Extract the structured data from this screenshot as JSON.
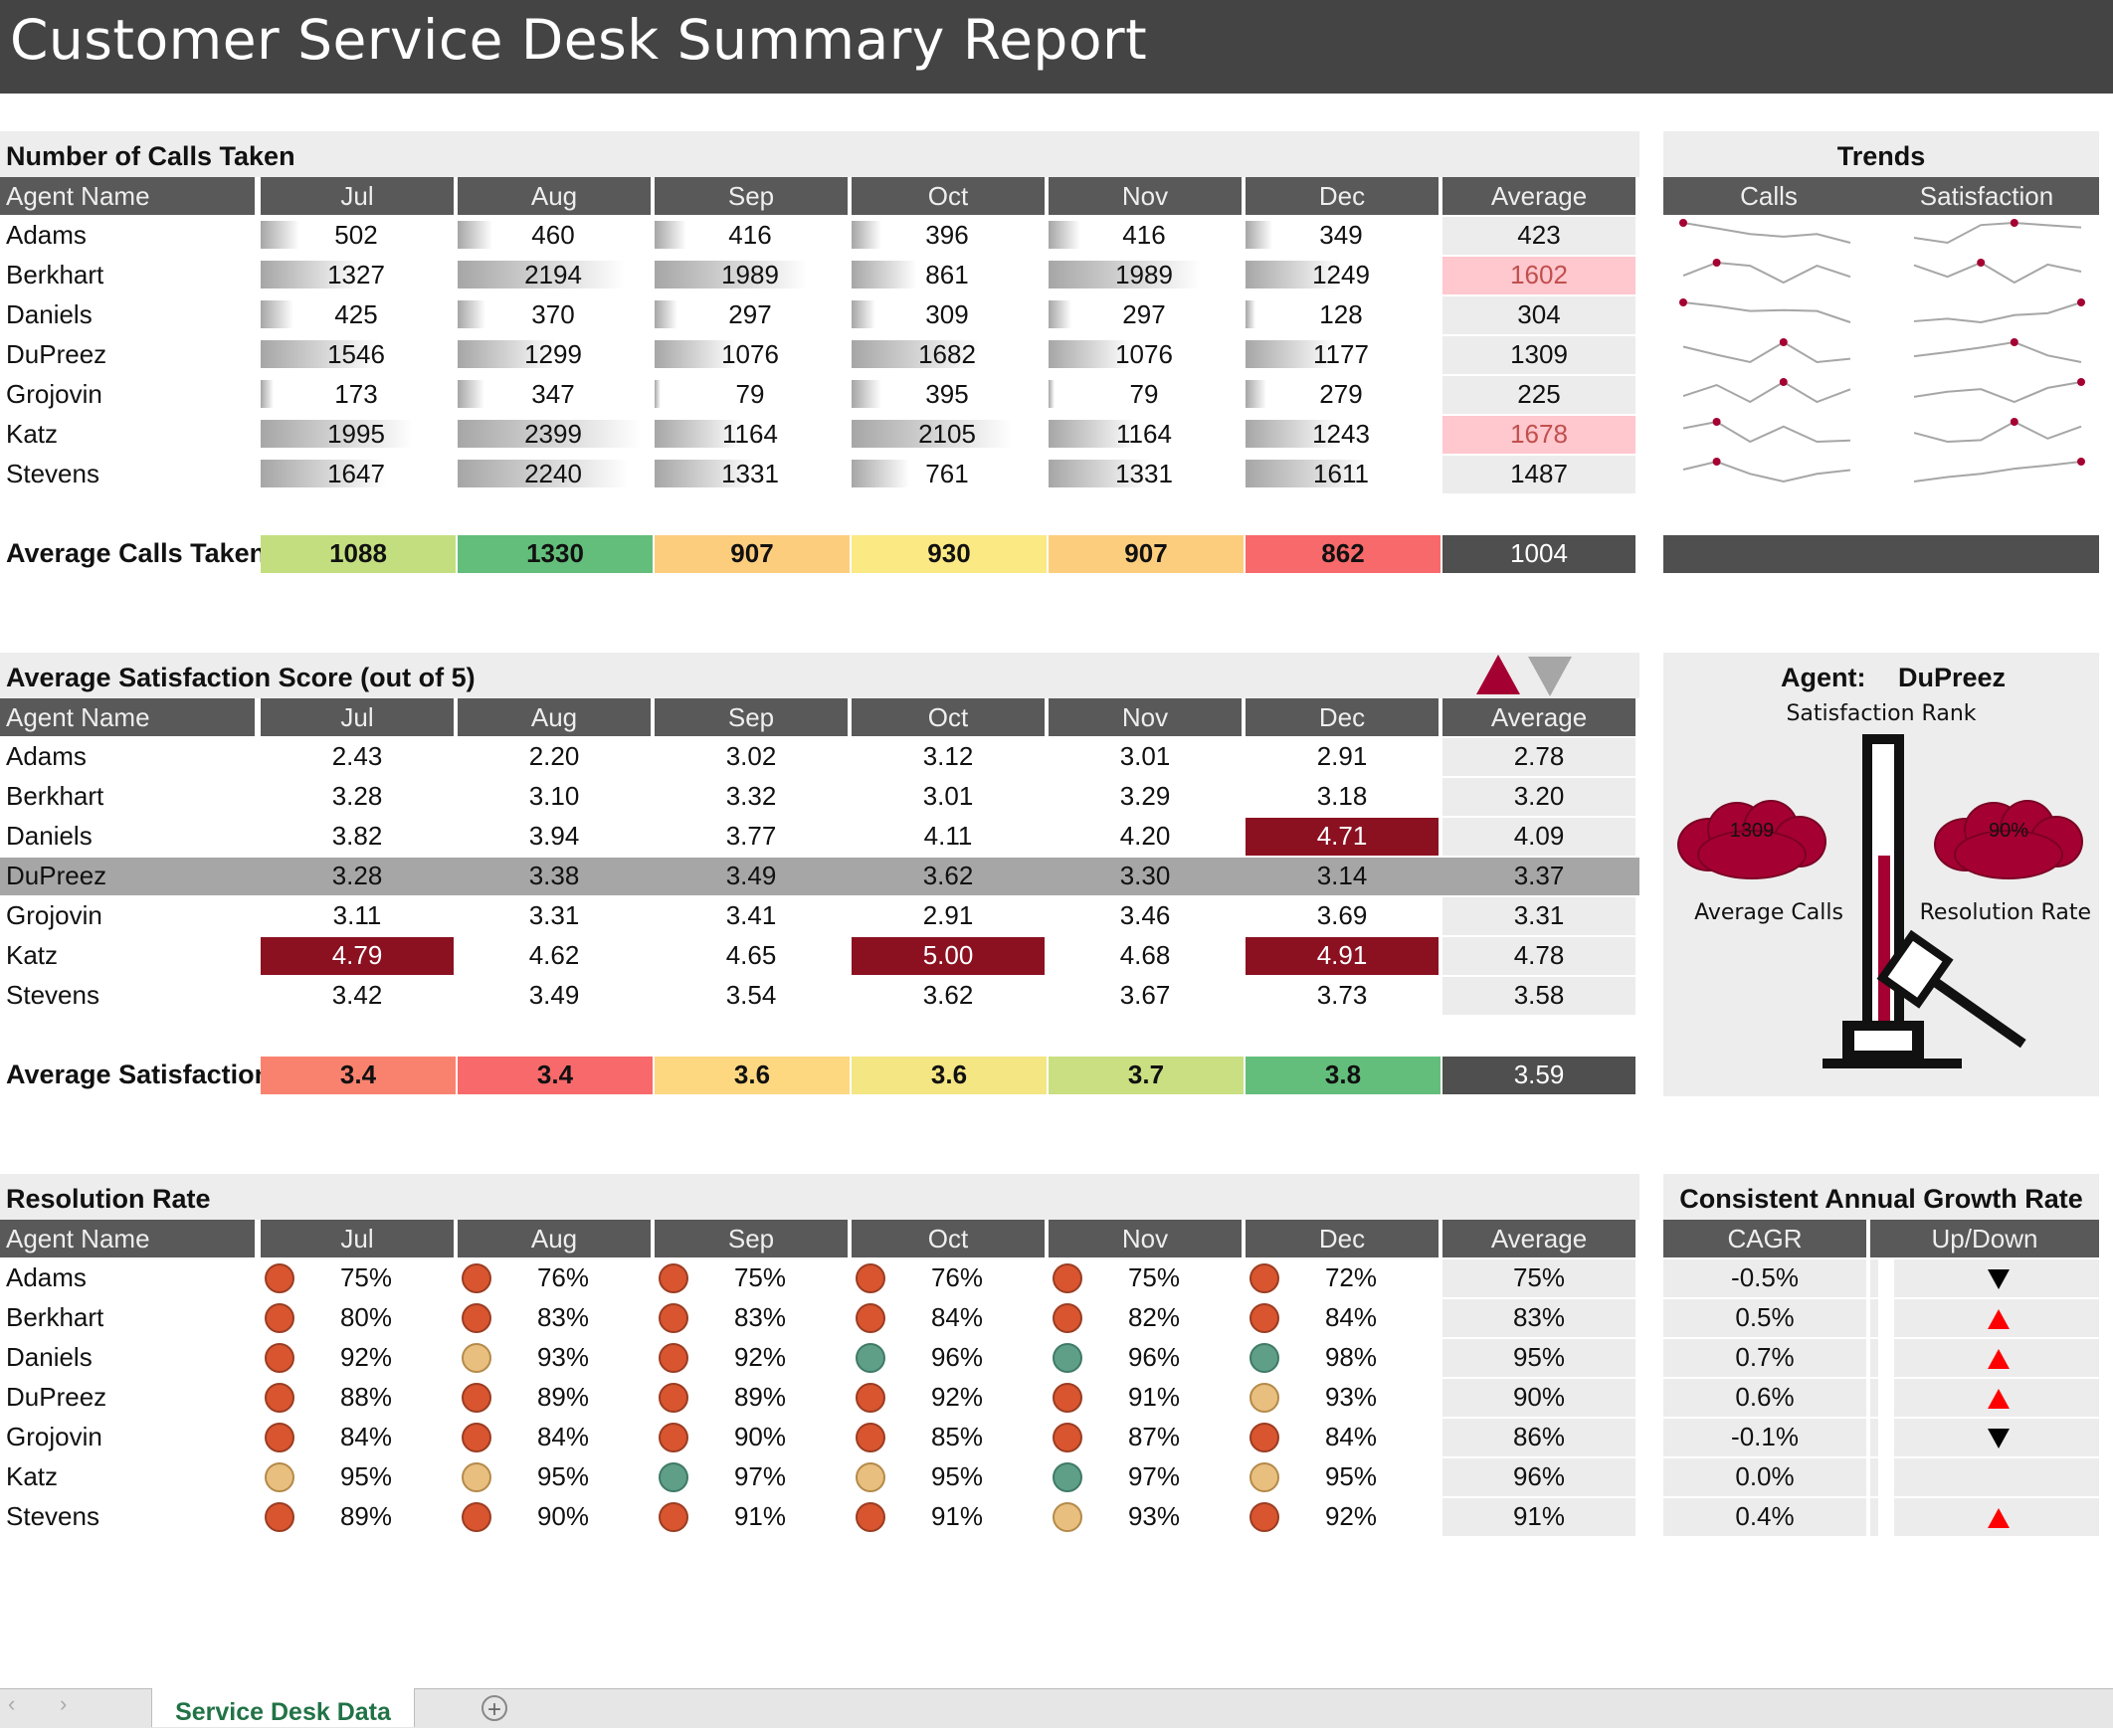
{
  "title": "Customer Service Desk Summary Report",
  "months": [
    "Jul",
    "Aug",
    "Sep",
    "Oct",
    "Nov",
    "Dec"
  ],
  "agent_col": "Agent Name",
  "avg_col": "Average",
  "agents": [
    "Adams",
    "Berkhart",
    "Daniels",
    "DuPreez",
    "Grojovin",
    "Katz",
    "Stevens"
  ],
  "calls": {
    "title": "Number of Calls Taken",
    "rows": [
      [
        "502",
        "460",
        "416",
        "396",
        "416",
        "349",
        "423"
      ],
      [
        "1327",
        "2194",
        "1989",
        "861",
        "1989",
        "1249",
        "1602"
      ],
      [
        "425",
        "370",
        "297",
        "309",
        "297",
        "128",
        "304"
      ],
      [
        "1546",
        "1299",
        "1076",
        "1682",
        "1076",
        "1177",
        "1309"
      ],
      [
        "173",
        "347",
        "79",
        "395",
        "79",
        "279",
        "225"
      ],
      [
        "1995",
        "2399",
        "1164",
        "2105",
        "1164",
        "1243",
        "1678"
      ],
      [
        "1647",
        "2240",
        "1331",
        "761",
        "1331",
        "1611",
        "1487"
      ]
    ],
    "bar_max": 2399,
    "avg_highlight_rows": [
      1,
      5
    ],
    "avg_highlight_color": "#ffc7ce",
    "avg_highlight_text": "#c0504d",
    "summary_label": "Average Calls Taken",
    "summary_values": [
      "1088",
      "1330",
      "907",
      "930",
      "907",
      "862",
      "1004"
    ],
    "summary_colors": [
      "#c3de7f",
      "#63be7b",
      "#fdcd7e",
      "#fbe983",
      "#fdcd7e",
      "#f8696b",
      "#4f4f4f"
    ]
  },
  "trends": {
    "title": "Trends",
    "col_calls": "Calls",
    "col_satisfaction": "Satisfaction",
    "line_color": "#a6a6a6",
    "marker_color": "#a50032"
  },
  "satisfaction": {
    "title": "Average Satisfaction Score (out of 5)",
    "rows": [
      [
        "2.43",
        "2.20",
        "3.02",
        "3.12",
        "3.01",
        "2.91",
        "2.78"
      ],
      [
        "3.28",
        "3.10",
        "3.32",
        "3.01",
        "3.29",
        "3.18",
        "3.20"
      ],
      [
        "3.82",
        "3.94",
        "3.77",
        "4.11",
        "4.20",
        "4.71",
        "4.09"
      ],
      [
        "3.28",
        "3.38",
        "3.49",
        "3.62",
        "3.30",
        "3.14",
        "3.37"
      ],
      [
        "3.11",
        "3.31",
        "3.41",
        "2.91",
        "3.46",
        "3.69",
        "3.31"
      ],
      [
        "4.79",
        "4.62",
        "4.65",
        "5.00",
        "4.68",
        "4.91",
        "4.78"
      ],
      [
        "3.42",
        "3.49",
        "3.54",
        "3.62",
        "3.67",
        "3.73",
        "3.58"
      ]
    ],
    "selected_row": 3,
    "high_cells": [
      [
        2,
        5
      ],
      [
        5,
        0
      ],
      [
        5,
        3
      ],
      [
        5,
        5
      ]
    ],
    "high_color": "#8b1121",
    "summary_label": "Average Satisfaction",
    "summary_values": [
      "3.4",
      "3.4",
      "3.6",
      "3.6",
      "3.7",
      "3.8",
      "3.59"
    ],
    "summary_colors": [
      "#f9826f",
      "#f8696b",
      "#fdd881",
      "#f3e683",
      "#c9df81",
      "#63be7b",
      "#4f4f4f"
    ]
  },
  "agent_panel": {
    "agent_label": "Agent:",
    "agent_value": "DuPreez",
    "rank_label": "Satisfaction Rank",
    "avg_calls_value": "1309",
    "avg_calls_label": "Average Calls",
    "resolution_value": "90%",
    "resolution_label": "Resolution Rate",
    "cloud_color": "#a50032"
  },
  "resolution": {
    "title": "Resolution Rate",
    "rows": [
      [
        "75%",
        "76%",
        "75%",
        "76%",
        "75%",
        "72%",
        "75%"
      ],
      [
        "80%",
        "83%",
        "83%",
        "84%",
        "82%",
        "84%",
        "83%"
      ],
      [
        "92%",
        "93%",
        "92%",
        "96%",
        "96%",
        "98%",
        "95%"
      ],
      [
        "88%",
        "89%",
        "89%",
        "92%",
        "91%",
        "93%",
        "90%"
      ],
      [
        "84%",
        "84%",
        "90%",
        "85%",
        "87%",
        "84%",
        "86%"
      ],
      [
        "95%",
        "95%",
        "97%",
        "95%",
        "97%",
        "95%",
        "96%"
      ],
      [
        "89%",
        "90%",
        "91%",
        "91%",
        "93%",
        "92%",
        "91%"
      ]
    ],
    "dot_colors": {
      "red": "#d85530",
      "amber": "#e8bf7f",
      "green": "#5f9f88"
    }
  },
  "cagr": {
    "title": "Consistent Annual Growth Rate",
    "col_cagr": "CAGR",
    "col_updown": "Up/Down",
    "rows": [
      {
        "value": "-0.5%",
        "dir": "down"
      },
      {
        "value": "0.5%",
        "dir": "up"
      },
      {
        "value": "0.7%",
        "dir": "up"
      },
      {
        "value": "0.6%",
        "dir": "up"
      },
      {
        "value": "-0.1%",
        "dir": "down"
      },
      {
        "value": "0.0%",
        "dir": "none"
      },
      {
        "value": "0.4%",
        "dir": "up"
      }
    ],
    "up_color": "#ff0000",
    "down_color": "#000000"
  },
  "sheet_tab": "Service Desk Data"
}
